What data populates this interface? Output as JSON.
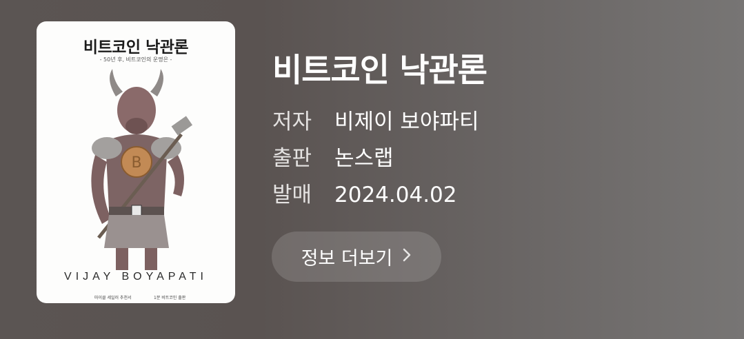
{
  "cover": {
    "title": "비트코인 낙관론",
    "subtitle": "- 50년 후, 비트코인의 운명은 -",
    "author_en": "VIJAY BOYAPATI",
    "footer_left": "마이클 세일러 추천서",
    "footer_right": "1분 비트코인 출판"
  },
  "book": {
    "title": "비트코인 낙관론",
    "author_label": "저자",
    "author": "비제이 보야파티",
    "publisher_label": "출판",
    "publisher": "논스랩",
    "date_label": "발매",
    "date": "2024.04.02"
  },
  "more_button": {
    "label": "정보 더보기",
    "icon": "chevron-right-icon"
  }
}
